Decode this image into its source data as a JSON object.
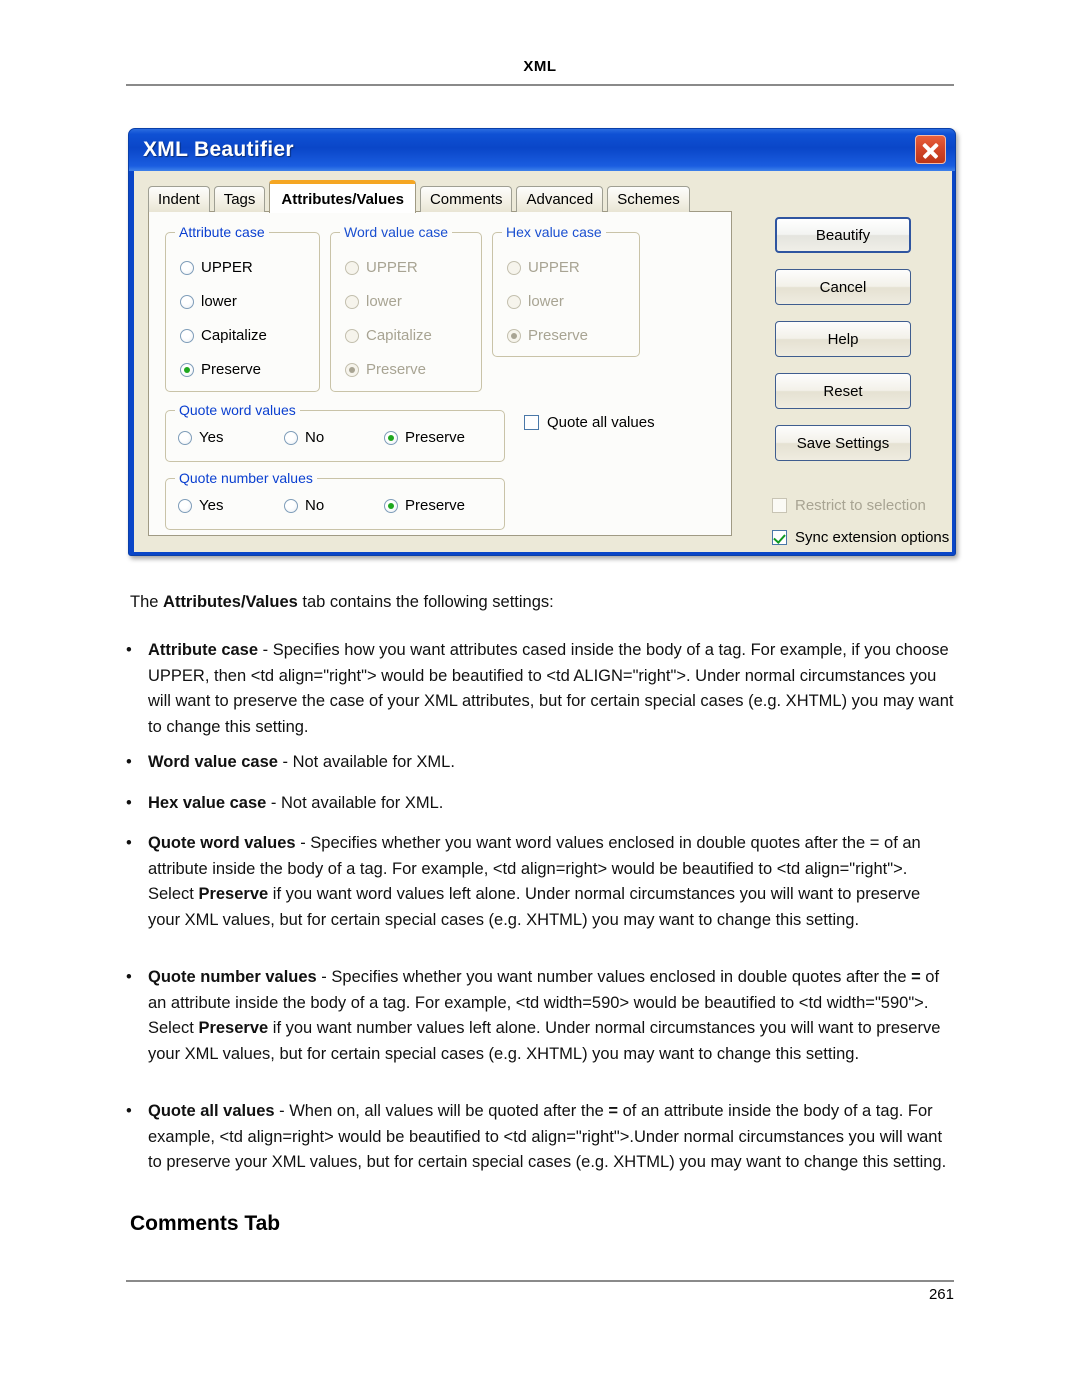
{
  "page": {
    "header_title": "XML",
    "page_number": "261",
    "section_heading": "Comments Tab"
  },
  "dialog": {
    "title": "XML Beautifier",
    "close_icon": "close-icon",
    "tabs": [
      {
        "label": "Indent",
        "active": false
      },
      {
        "label": "Tags",
        "active": false
      },
      {
        "label": "Attributes/Values",
        "active": true
      },
      {
        "label": "Comments",
        "active": false
      },
      {
        "label": "Advanced",
        "active": false
      },
      {
        "label": "Schemes",
        "active": false
      }
    ],
    "groups": [
      {
        "legend": "Attribute case",
        "enabled": true,
        "options": [
          {
            "label": "UPPER",
            "selected": false
          },
          {
            "label": "lower",
            "selected": false
          },
          {
            "label": "Capitalize",
            "selected": false
          },
          {
            "label": "Preserve",
            "selected": true
          }
        ]
      },
      {
        "legend": "Word value case",
        "enabled": false,
        "options": [
          {
            "label": "UPPER",
            "selected": false
          },
          {
            "label": "lower",
            "selected": false
          },
          {
            "label": "Capitalize",
            "selected": false
          },
          {
            "label": "Preserve",
            "selected": true
          }
        ]
      },
      {
        "legend": "Hex value case",
        "enabled": false,
        "options": [
          {
            "label": "UPPER",
            "selected": false
          },
          {
            "label": "lower",
            "selected": false
          },
          {
            "label": "Preserve",
            "selected": true
          }
        ]
      },
      {
        "legend": "Quote word values",
        "enabled": true,
        "options": [
          {
            "label": "Yes",
            "selected": false
          },
          {
            "label": "No",
            "selected": false
          },
          {
            "label": "Preserve",
            "selected": true
          }
        ]
      },
      {
        "legend": "Quote number values",
        "enabled": true,
        "options": [
          {
            "label": "Yes",
            "selected": false
          },
          {
            "label": "No",
            "selected": false
          },
          {
            "label": "Preserve",
            "selected": true
          }
        ]
      }
    ],
    "quote_all_values": {
      "label": "Quote all values",
      "checked": false,
      "enabled": true
    },
    "buttons": [
      {
        "label": "Beautify",
        "default": true
      },
      {
        "label": "Cancel",
        "default": false
      },
      {
        "label": "Help",
        "default": false
      },
      {
        "label": "Reset",
        "default": false
      },
      {
        "label": "Save Settings",
        "default": false
      }
    ],
    "side_checkboxes": [
      {
        "label": "Restrict to selection",
        "checked": false,
        "enabled": false
      },
      {
        "label": "Sync extension options",
        "checked": true,
        "enabled": true
      }
    ],
    "colors": {
      "titlebar_blue": "#0a46c8",
      "active_tab_accent": "#f5a623",
      "dialog_face": "#ece9d8",
      "legend_blue": "#0a3fd0",
      "radio_dot_green": "#1fa81f",
      "close_red": "#d4472a"
    }
  },
  "body_text": {
    "intro_html": "The <b>Attributes/Values</b> tab contains the following settings:",
    "bullets": [
      "<b>Attribute case</b> - Specifies how you want attributes cased inside the body of a tag. For example, if you choose UPPER, then &lt;td align=\"right\"&gt; would be beautified to &lt;td ALIGN=\"right\"&gt;. Under normal circumstances you will want to preserve the case of your XML attributes, but for certain special cases (e.g. XHTML) you may want to change this setting.",
      "<b>Word value case</b> - Not available for XML.",
      "<b>Hex value case</b> - Not available for XML.",
      "<b>Quote word values</b> - Specifies whether you want word values enclosed in double quotes after the = of an attribute inside the body of a tag. For example, &lt;td align=right&gt; would be beautified to &lt;td align=\"right\"&gt;. Select <b>Preserve</b> if you want word values left alone. Under normal circumstances you will want to preserve your XML values, but for certain special cases (e.g. XHTML) you may want to change this setting.",
      "<b>Quote number values</b> - Specifies whether you want number values enclosed in double quotes after the <b>=</b> of an attribute inside the body of a tag. For example, &lt;td width=590&gt; would be beautified to &lt;td width=\"590\"&gt;. Select <b>Preserve</b> if you want number values left alone. Under normal circumstances you will want to preserve your XML values, but for certain special cases (e.g. XHTML) you may want to change this setting.",
      "<b>Quote all values</b> - When on, all values will be quoted after the <b>=</b> of an attribute inside the body of a tag. For example, &lt;td align=right&gt; would be beautified to &lt;td align=\"right\"&gt;.Under normal circumstances you will want to preserve your XML values, but for certain special cases (e.g. XHTML) you may want to change this setting."
    ],
    "bullet_marker": "•"
  }
}
